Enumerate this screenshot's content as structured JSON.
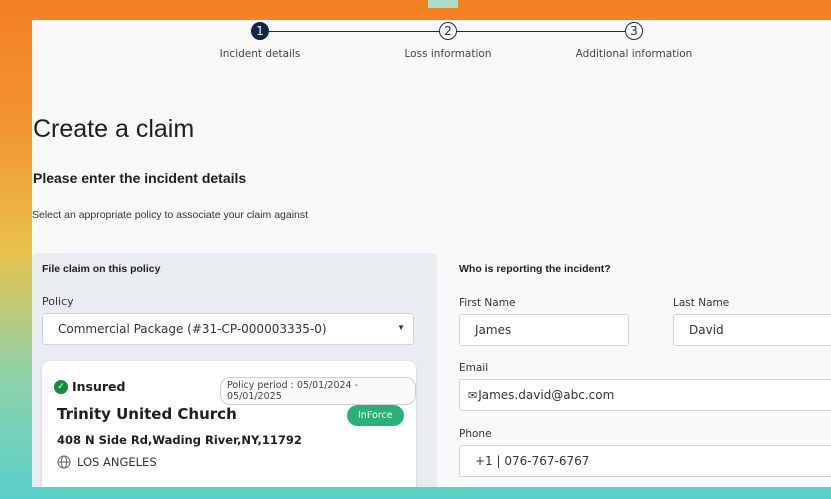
{
  "stepper": {
    "steps": [
      {
        "number": "1",
        "label": "Incident details",
        "active": true
      },
      {
        "number": "2",
        "label": "Loss information",
        "active": false
      },
      {
        "number": "3",
        "label": "Additional information",
        "active": false
      }
    ]
  },
  "page": {
    "title": "Create a claim",
    "subtitle": "Please enter the incident details",
    "hint": "Select an appropriate policy to associate your claim against"
  },
  "policy_panel": {
    "title": "File claim on this policy",
    "policy_label": "Policy",
    "policy_value": "Commercial Package (#31-CP-000003335-0)",
    "card": {
      "status": "Insured",
      "period": "Policy period : 05/01/2024 - 05/01/2025",
      "name": "Trinity United Church",
      "badge": "InForce",
      "address": "408 N Side Rd,Wading River,NY,11792",
      "city": "LOS ANGELES"
    }
  },
  "reporter": {
    "title": "Who is reporting the incident?",
    "first_name_label": "First Name",
    "first_name": "James",
    "last_name_label": "Last Name",
    "last_name": "David",
    "email_label": "Email",
    "email": "James.david@abc.com",
    "phone_label": "Phone",
    "phone": "+1 | 076-767-6767"
  },
  "colors": {
    "accent_dark": "#0e2747",
    "inforce_green": "#2bb07a",
    "insured_green": "#1a8a3e",
    "frame_orange": "#f47f25",
    "frame_teal": "#57d0c9"
  },
  "icons": [
    "check-circle-icon",
    "globe-icon",
    "mail-icon",
    "chevron-down-icon"
  ]
}
